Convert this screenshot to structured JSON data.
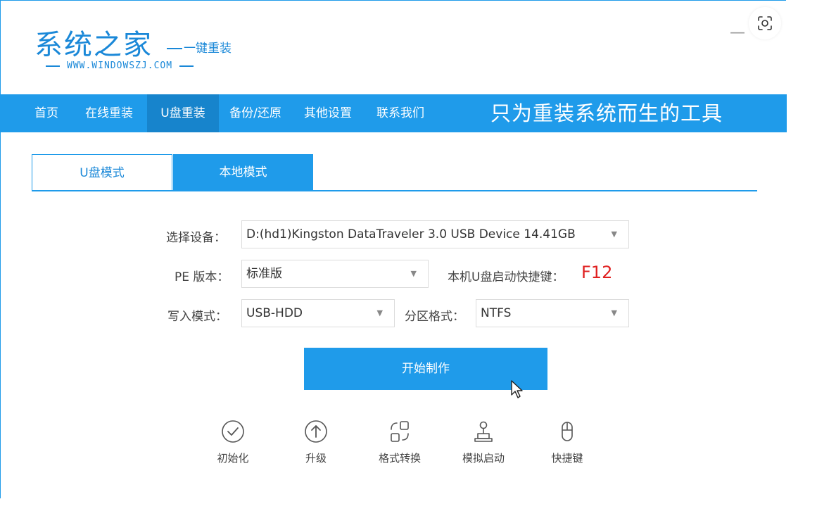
{
  "logo": {
    "title": "系统之家",
    "subtitle": "一键重装",
    "url": "WWW.WINDOWSZJ.COM"
  },
  "window": {
    "minimize_label": "—"
  },
  "nav": {
    "items": [
      "首页",
      "在线重装",
      "U盘重装",
      "备份/还原",
      "其他设置",
      "联系我们"
    ],
    "active": "U盘重装",
    "slogan": "只为重装系统而生的工具"
  },
  "tabs": {
    "usb_mode": "U盘模式",
    "local_mode": "本地模式",
    "active": "U盘模式"
  },
  "form": {
    "device_label": "选择设备：",
    "device_value": "D:(hd1)Kingston DataTraveler 3.0 USB Device 14.41GB",
    "pe_label": "PE 版本：",
    "pe_value": "标准版",
    "hotkey_hint": "本机U盘启动快捷键：",
    "hotkey_value": "F12",
    "write_label": "写入模式：",
    "write_value": "USB-HDD",
    "partition_label": "分区格式：",
    "partition_value": "NTFS",
    "arrow": "▼"
  },
  "start_button": "开始制作",
  "tools": [
    {
      "label": "初始化",
      "icon": "check-circle-icon"
    },
    {
      "label": "升级",
      "icon": "arrow-up-circle-icon"
    },
    {
      "label": "格式转换",
      "icon": "convert-icon"
    },
    {
      "label": "模拟启动",
      "icon": "joystick-icon"
    },
    {
      "label": "快捷键",
      "icon": "mouse-icon"
    }
  ],
  "colors": {
    "accent": "#1f9bea",
    "active_nav": "#1784cc",
    "hotkey": "#e02020",
    "logo": "#1a88d8"
  }
}
